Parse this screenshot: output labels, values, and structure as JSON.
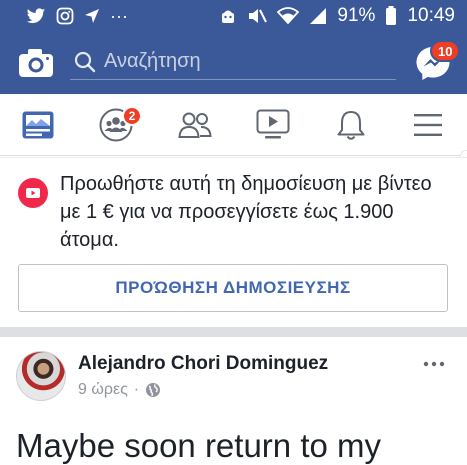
{
  "status_bar": {
    "battery_percent": "91%",
    "time": "10:49",
    "notification_dots": "···"
  },
  "top_bar": {
    "search_placeholder": "Αναζήτηση",
    "messenger_badge": "10"
  },
  "nav": {
    "items": [
      {
        "icon": "news-feed-icon",
        "active": true
      },
      {
        "icon": "groups-icon",
        "badge": "2"
      },
      {
        "icon": "friends-icon"
      },
      {
        "icon": "watch-video-icon"
      },
      {
        "icon": "notifications-bell-icon"
      },
      {
        "icon": "menu-icon"
      }
    ]
  },
  "promote": {
    "text": "Προωθήστε αυτή τη δημοσίευση με βίντεο με 1 € για να προσεγγίσετε έως 1.900 άτομα.",
    "button_label": "ΠΡΟΏΘΗΣΗ ΔΗΜΟΣΙΕΥΣΗΣ"
  },
  "post": {
    "author": "Alejandro Chori Dominguez",
    "time": "9 ώρες",
    "separator": "·",
    "text": "Maybe soon return to my"
  },
  "colors": {
    "brand_blue": "#3b5998",
    "link_blue": "#4267b2",
    "badge_red": "#f03d25",
    "promote_red": "#f0284a"
  }
}
